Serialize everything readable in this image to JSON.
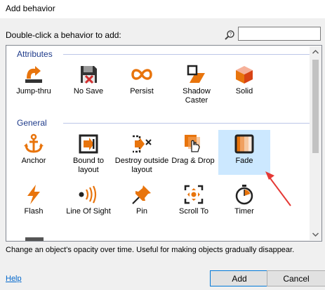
{
  "window": {
    "title": "Add behavior"
  },
  "search": {
    "prompt": "Double-click a behavior to add:",
    "value": "",
    "icon": "search-icon"
  },
  "groups": [
    {
      "name": "Attributes",
      "items": [
        {
          "label": "Jump-thru",
          "icon": "jump-thru-icon"
        },
        {
          "label": "No Save",
          "icon": "no-save-icon"
        },
        {
          "label": "Persist",
          "icon": "persist-icon"
        },
        {
          "label": "Shadow Caster",
          "icon": "shadow-caster-icon"
        },
        {
          "label": "Solid",
          "icon": "solid-icon"
        }
      ]
    },
    {
      "name": "General",
      "items": [
        {
          "label": "Anchor",
          "icon": "anchor-icon"
        },
        {
          "label": "Bound to layout",
          "icon": "bound-to-layout-icon"
        },
        {
          "label": "Destroy outside layout",
          "icon": "destroy-outside-layout-icon"
        },
        {
          "label": "Drag & Drop",
          "icon": "drag-drop-icon"
        },
        {
          "label": "Fade",
          "icon": "fade-icon",
          "selected": true
        },
        {
          "label": "Flash",
          "icon": "flash-icon"
        },
        {
          "label": "Line Of Sight",
          "icon": "line-of-sight-icon"
        },
        {
          "label": "Pin",
          "icon": "pin-icon"
        },
        {
          "label": "Scroll To",
          "icon": "scroll-to-icon"
        },
        {
          "label": "Timer",
          "icon": "timer-icon"
        }
      ]
    }
  ],
  "description": "Change an object's opacity over time.  Useful for making objects gradually disappear.",
  "footer": {
    "help": "Help",
    "add": "Add",
    "cancel": "Cancel"
  },
  "colors": {
    "accent": "#e8740c",
    "selection": "#cce8ff",
    "group_title": "#1e3a8a",
    "annotation_arrow": "#e53935"
  }
}
